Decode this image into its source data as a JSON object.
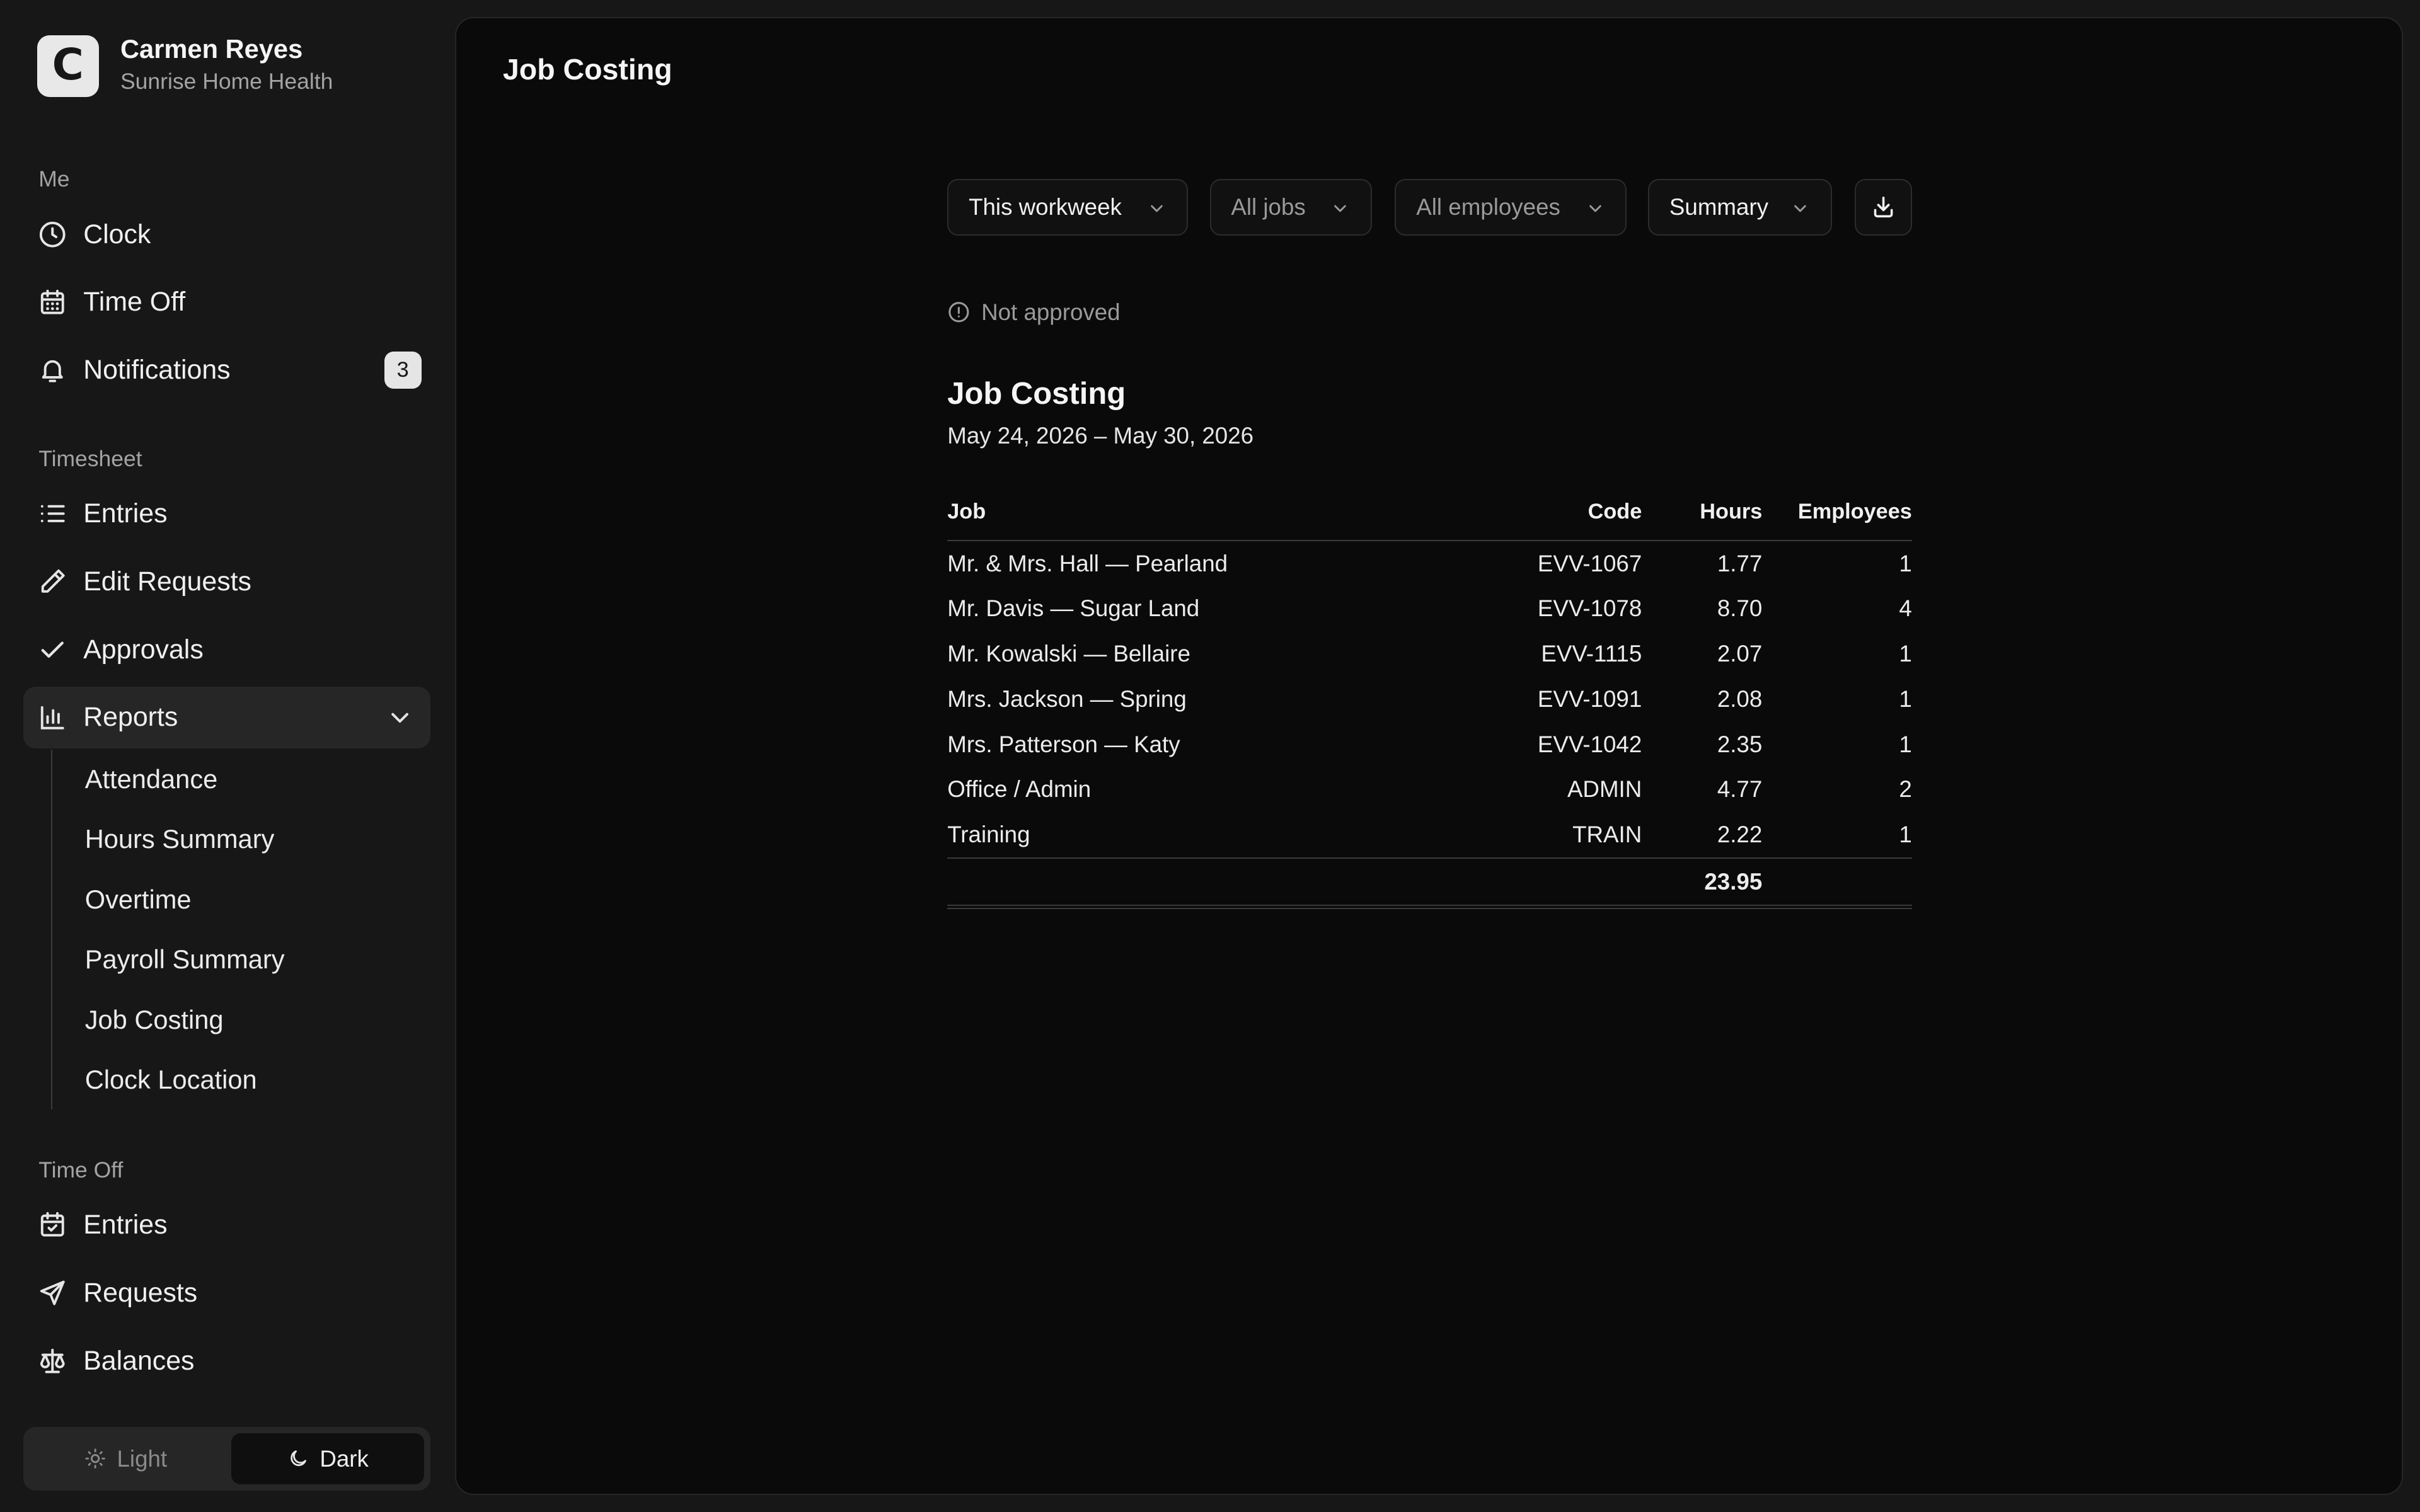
{
  "org": {
    "logo_letter": "C",
    "user": "Carmen Reyes",
    "company": "Sunrise Home Health"
  },
  "sidebar": {
    "me_label": "Me",
    "me_items": [
      {
        "label": "Clock",
        "icon": "clock-icon"
      },
      {
        "label": "Time Off",
        "icon": "calendar-icon"
      },
      {
        "label": "Notifications",
        "icon": "bell-icon",
        "badge": "3"
      }
    ],
    "timesheet_label": "Timesheet",
    "timesheet_items": [
      {
        "label": "Entries",
        "icon": "list-icon"
      },
      {
        "label": "Edit Requests",
        "icon": "pencil-icon"
      },
      {
        "label": "Approvals",
        "icon": "check-icon"
      },
      {
        "label": "Reports",
        "icon": "bar-chart-icon"
      }
    ],
    "reports_sub": [
      "Attendance",
      "Hours Summary",
      "Overtime",
      "Payroll Summary",
      "Job Costing",
      "Clock Location"
    ],
    "timeoff_label": "Time Off",
    "timeoff_items": [
      {
        "label": "Entries",
        "icon": "calendar-check-icon"
      },
      {
        "label": "Requests",
        "icon": "send-icon"
      },
      {
        "label": "Balances",
        "icon": "scale-icon"
      }
    ],
    "theme": {
      "light": "Light",
      "dark": "Dark",
      "selected": "Dark"
    }
  },
  "main": {
    "title": "Job Costing",
    "filters": {
      "period": "This workweek",
      "jobs": "All jobs",
      "employees": "All employees",
      "view": "Summary"
    },
    "status": "Not approved",
    "report_title": "Job Costing",
    "date_range": "May 24, 2026 – May 30, 2026",
    "table": {
      "headers": {
        "job": "Job",
        "code": "Code",
        "hours": "Hours",
        "employees": "Employees"
      },
      "rows": [
        {
          "job": "Mr. & Mrs. Hall — Pearland",
          "code": "EVV-1067",
          "hours": "1.77",
          "employees": "1"
        },
        {
          "job": "Mr. Davis — Sugar Land",
          "code": "EVV-1078",
          "hours": "8.70",
          "employees": "4"
        },
        {
          "job": "Mr. Kowalski — Bellaire",
          "code": "EVV-1115",
          "hours": "2.07",
          "employees": "1"
        },
        {
          "job": "Mrs. Jackson — Spring",
          "code": "EVV-1091",
          "hours": "2.08",
          "employees": "1"
        },
        {
          "job": "Mrs. Patterson — Katy",
          "code": "EVV-1042",
          "hours": "2.35",
          "employees": "1"
        },
        {
          "job": "Office / Admin",
          "code": "ADMIN",
          "hours": "4.77",
          "employees": "2"
        },
        {
          "job": "Training",
          "code": "TRAIN",
          "hours": "2.22",
          "employees": "1"
        }
      ],
      "total_hours": "23.95"
    }
  }
}
